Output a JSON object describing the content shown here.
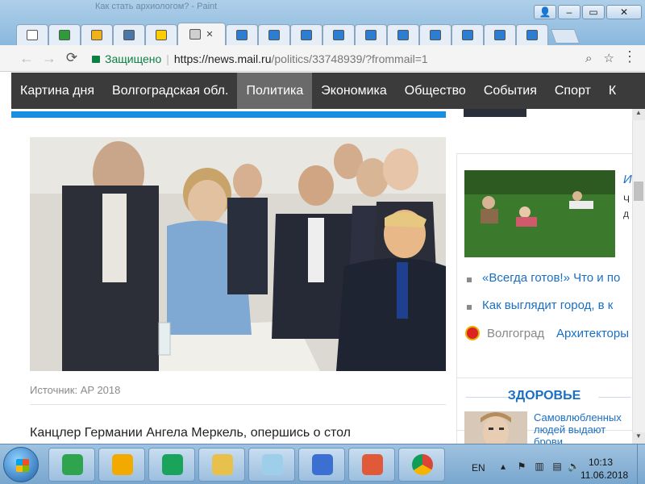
{
  "window": {
    "title_fragment": "Как стать архиологом? - Paint",
    "controls": {
      "minimize": "–",
      "maximize": "▭",
      "close": "✕"
    }
  },
  "tabs": [
    {
      "icon": "document-icon",
      "color": "#ffffff",
      "label": ":"
    },
    {
      "icon": "green-square-icon",
      "color": "#2e9b3a",
      "label": "A"
    },
    {
      "icon": "image-icon",
      "color": "#f0b21a",
      "label": "A"
    },
    {
      "icon": "vk-icon",
      "color": "#4a76a8",
      "label": "VK"
    },
    {
      "icon": "mail-at-icon",
      "color": "#ffcc00",
      "label": "A"
    },
    {
      "icon": "page-icon",
      "color": "#cfcfcf",
      "label": "C",
      "active": true
    },
    {
      "icon": "window-icon",
      "color": "#2a7fd4",
      "label": "I"
    },
    {
      "icon": "window-icon",
      "color": "#2a7fd4",
      "label": "I"
    },
    {
      "icon": "window-icon",
      "color": "#2a7fd4",
      "label": "I"
    },
    {
      "icon": "window-icon",
      "color": "#2a7fd4",
      "label": "I"
    },
    {
      "icon": "window-icon",
      "color": "#2a7fd4",
      "label": "I"
    },
    {
      "icon": "window-icon",
      "color": "#2a7fd4",
      "label": "I"
    },
    {
      "icon": "window-icon",
      "color": "#2a7fd4",
      "label": "I"
    },
    {
      "icon": "wave-icon",
      "color": "#2a7fd4",
      "label": "I"
    },
    {
      "icon": "wave-icon",
      "color": "#2a7fd4",
      "label": "I"
    },
    {
      "icon": "help-icon",
      "color": "#2a7fd4",
      "label": "?"
    }
  ],
  "address_bar": {
    "secure_label": "Защищено",
    "url_host": "https://news.mail.ru",
    "url_path": "/politics/33748939/?frommail=1"
  },
  "nav": {
    "items": [
      "Картина дня",
      "Волгоградская обл.",
      "Политика",
      "Экономика",
      "Общество",
      "События",
      "Спорт",
      "К"
    ],
    "active_index": 2
  },
  "article": {
    "photo_source": "Источник: AP 2018",
    "first_line": "Канцлер Германии Ангела Меркель, опершись о стол"
  },
  "sidebar": {
    "title_cut": "И",
    "snippet1": "Ч",
    "snippet2": "д",
    "links": [
      "«Всегда готов!» Что и по",
      "Как выглядит город, в к"
    ],
    "region_name": "Волгоград",
    "region_link": "Архитекторы",
    "health_heading": "ЗДОРОВЬЕ",
    "health_text": "Самовлюбленных людей выдают брови"
  },
  "taskbar": {
    "apps": [
      {
        "name": "alisa-icon",
        "color": "#2ea44f"
      },
      {
        "name": "music-icon",
        "color": "#f2a900"
      },
      {
        "name": "mail-agent-icon",
        "color": "#1aa35a"
      },
      {
        "name": "explorer-icon",
        "color": "#e8c04c"
      },
      {
        "name": "notepad-icon",
        "color": "#9ecfea"
      },
      {
        "name": "wordpad-icon",
        "color": "#3b6fd1"
      },
      {
        "name": "paint-icon",
        "color": "#e05a3a"
      },
      {
        "name": "chrome-icon",
        "color": "#db4437"
      }
    ],
    "lang": "EN",
    "time": "10:13",
    "date": "11.06.2018"
  }
}
